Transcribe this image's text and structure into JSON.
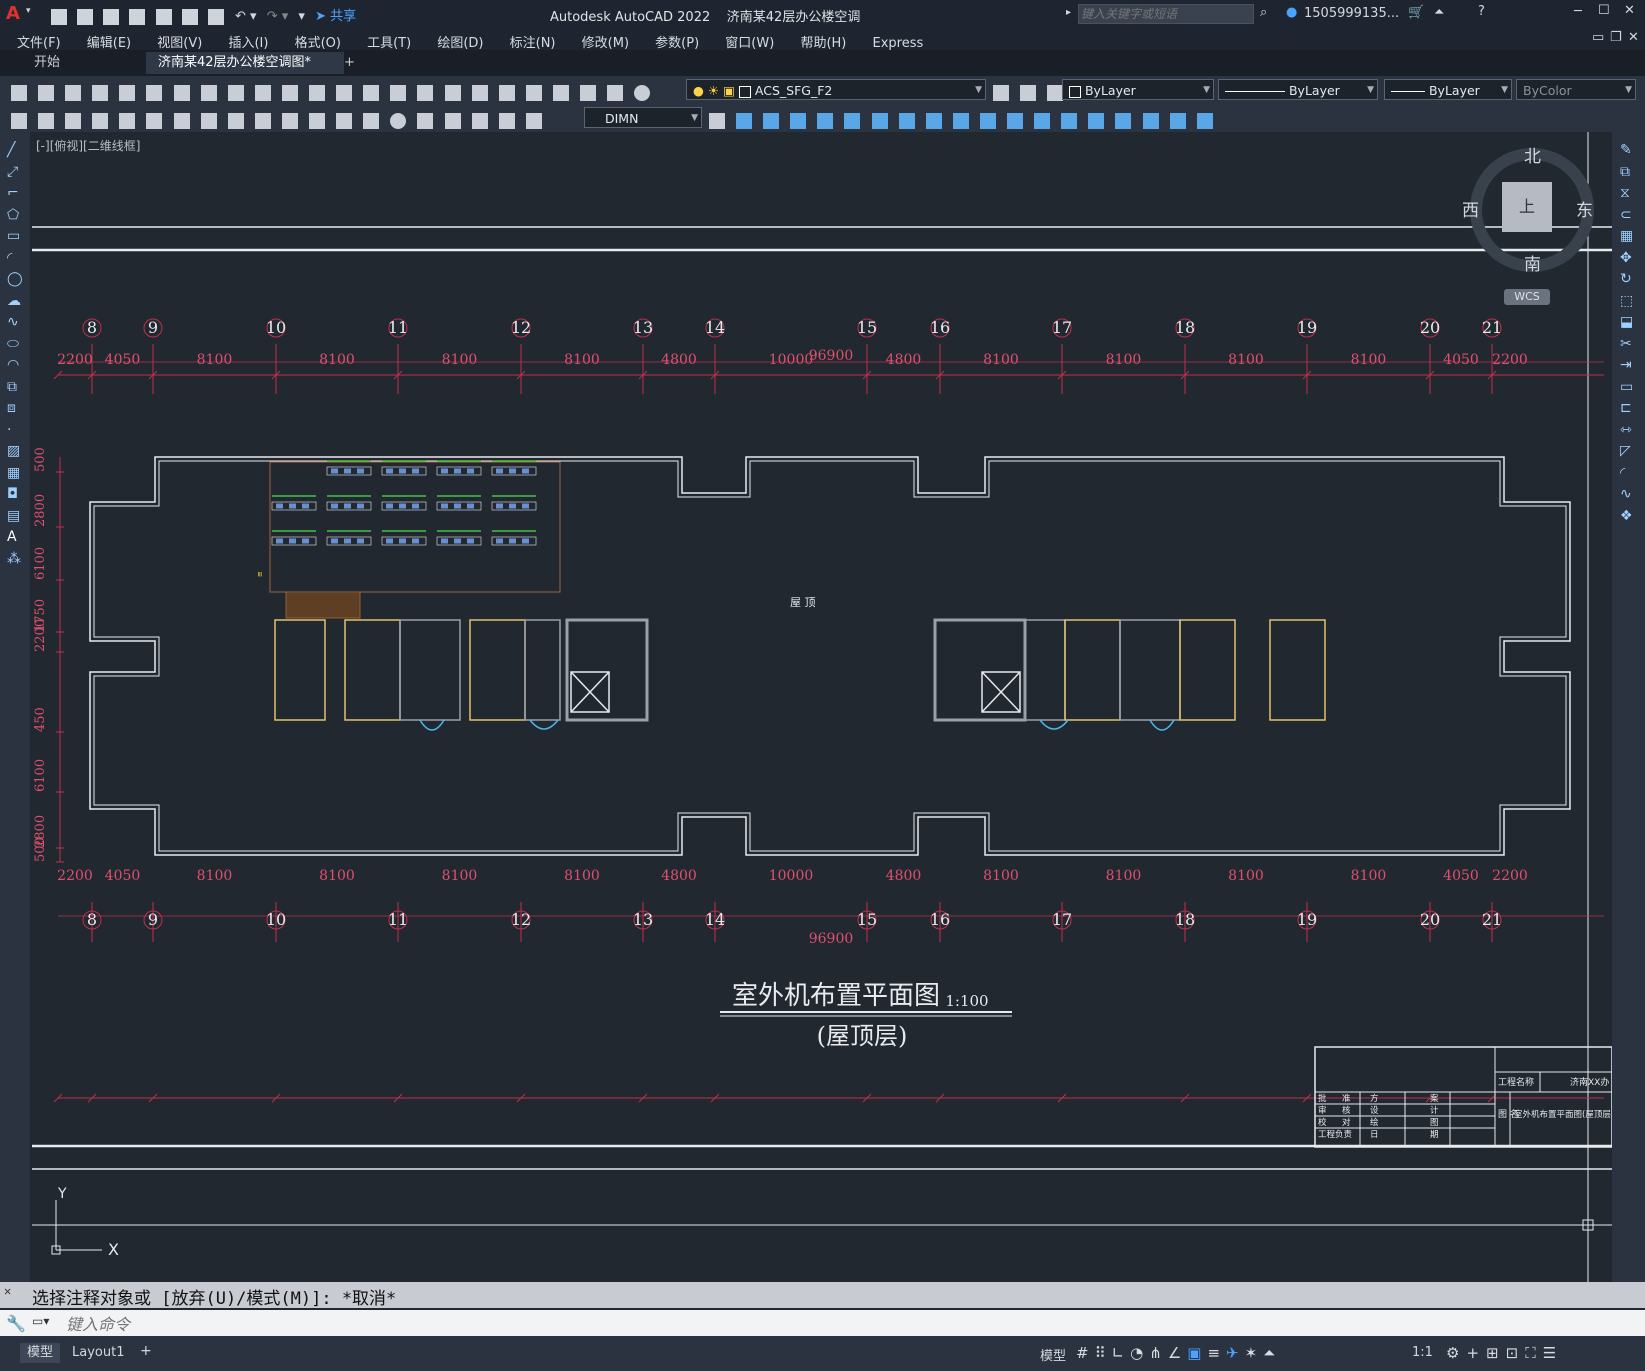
{
  "app": {
    "title": "Autodesk AutoCAD 2022",
    "filename": "济南某42层办公楼空调图.dwg",
    "share_label": "共享",
    "search_placeholder": "键入关键字或短语",
    "user": "1505999135...",
    "logo": "A"
  },
  "menu": [
    "文件(F)",
    "编辑(E)",
    "视图(V)",
    "插入(I)",
    "格式(O)",
    "工具(T)",
    "绘图(D)",
    "标注(N)",
    "修改(M)",
    "参数(P)",
    "窗口(W)",
    "帮助(H)",
    "Express"
  ],
  "tabs": {
    "start": "开始",
    "active": "济南某42层办公楼空调图*",
    "close": "✕",
    "add": "+"
  },
  "toolbar": {
    "layer": "ACS_SFG_F2",
    "color": "ByLayer",
    "linetype": "ByLayer",
    "lineweight": "ByLayer",
    "plotstyle": "ByColor",
    "dimstyle": "DIMN"
  },
  "viewport_label": "[-][俯视][二维线框]",
  "viewcube": {
    "north": "北",
    "south": "南",
    "east": "东",
    "west": "西",
    "top": "上",
    "wcs": "WCS"
  },
  "grid_axes": [
    "8",
    "9",
    "10",
    "11",
    "12",
    "13",
    "14",
    "15",
    "16",
    "17",
    "18",
    "19",
    "20",
    "21"
  ],
  "top_dims": [
    "2200",
    "4050",
    "8100",
    "8100",
    "8100",
    "8100",
    "4800",
    "10000",
    "4800",
    "8100",
    "8100",
    "8100",
    "8100",
    "4050",
    "2200"
  ],
  "total_dim": "96900",
  "left_dims": [
    "500",
    "2800",
    "6100",
    "450",
    "2200",
    "1750",
    "6100",
    "2800",
    "500"
  ],
  "roof_label": "屋 顶",
  "title_block": {
    "main_title": "室外机布置平面图",
    "scale": "1:100",
    "sub_title": "(屋顶层)",
    "project_label": "工程名称",
    "project_value": "济南XX办",
    "drawing_name": "室外机布置平面图(屋顶层)",
    "rows": [
      [
        "批",
        "准",
        "方",
        "案"
      ],
      [
        "审",
        "核",
        "设",
        "计"
      ],
      [
        "校",
        "对",
        "绘",
        "图"
      ],
      [
        "工程负责",
        "",
        "日",
        "期"
      ]
    ],
    "col_label": "图 名"
  },
  "ucs": {
    "x": "X",
    "y": "Y"
  },
  "command": {
    "history": "选择注释对象或 [放弃(U)/模式(M)]: *取消*",
    "placeholder": "键入命令"
  },
  "layout_tabs": [
    "模型",
    "Layout1",
    "+"
  ],
  "status": {
    "model": "模型",
    "scale": "1:1"
  }
}
